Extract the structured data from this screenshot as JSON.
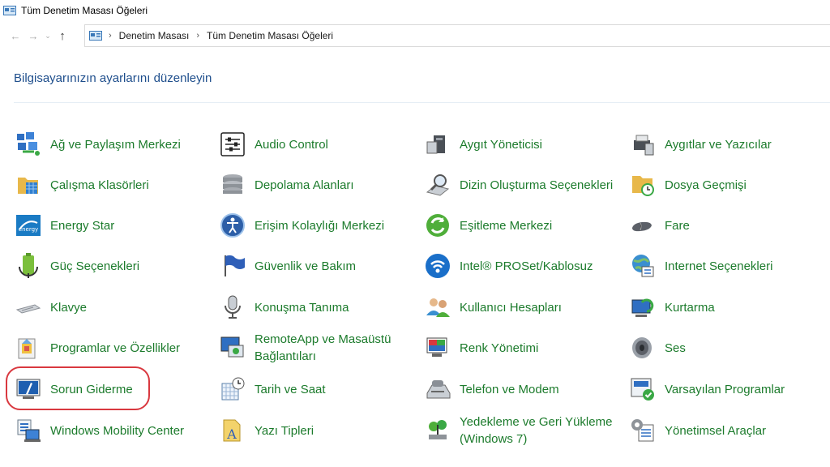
{
  "window": {
    "title": "Tüm Denetim Masası Öğeleri"
  },
  "address": {
    "crumbs": [
      "Denetim Masası",
      "Tüm Denetim Masası Öğeleri"
    ],
    "back_icon": "back-arrow-icon",
    "forward_icon": "forward-arrow-icon",
    "up_icon": "up-arrow-icon"
  },
  "heading": "Bilgisayarınızın ayarlarını düzenleyin",
  "colors": {
    "link": "#1c7b2c",
    "heading": "#1e4e8c",
    "highlight": "#d9383f"
  },
  "columns": [
    {
      "items": [
        {
          "label": "Ağ ve Paylaşım Merkezi",
          "icon": "network-icon"
        },
        {
          "label": "Çalışma Klasörleri",
          "icon": "work-folders-icon"
        },
        {
          "label": "Energy Star",
          "icon": "energy-star-icon"
        },
        {
          "label": "Güç Seçenekleri",
          "icon": "power-options-icon"
        },
        {
          "label": "Klavye",
          "icon": "keyboard-icon"
        },
        {
          "label": "Programlar ve Özellikler",
          "icon": "programs-icon"
        },
        {
          "label": "Sorun Giderme",
          "icon": "troubleshooting-icon",
          "highlighted": true
        },
        {
          "label": "Windows Mobility Center",
          "icon": "mobility-center-icon"
        }
      ]
    },
    {
      "items": [
        {
          "label": "Audio Control",
          "icon": "audio-control-icon"
        },
        {
          "label": "Depolama Alanları",
          "icon": "storage-spaces-icon"
        },
        {
          "label": "Erişim Kolaylığı Merkezi",
          "icon": "ease-of-access-icon"
        },
        {
          "label": "Güvenlik ve Bakım",
          "icon": "security-maintenance-icon"
        },
        {
          "label": "Konuşma Tanıma",
          "icon": "speech-recognition-icon"
        },
        {
          "label": "RemoteApp ve Masaüstü Bağlantıları",
          "icon": "remoteapp-icon"
        },
        {
          "label": "Tarih ve Saat",
          "icon": "date-time-icon"
        },
        {
          "label": "Yazı Tipleri",
          "icon": "fonts-icon"
        }
      ]
    },
    {
      "items": [
        {
          "label": "Aygıt Yöneticisi",
          "icon": "device-manager-icon"
        },
        {
          "label": "Dizin Oluşturma Seçenekleri",
          "icon": "indexing-options-icon"
        },
        {
          "label": "Eşitleme Merkezi",
          "icon": "sync-center-icon"
        },
        {
          "label": "Intel® PROSet/Kablosuz",
          "icon": "wireless-icon"
        },
        {
          "label": "Kullanıcı Hesapları",
          "icon": "user-accounts-icon"
        },
        {
          "label": "Renk Yönetimi",
          "icon": "color-management-icon"
        },
        {
          "label": "Telefon ve Modem",
          "icon": "phone-modem-icon"
        },
        {
          "label": "Yedekleme ve Geri Yükleme (Windows 7)",
          "icon": "backup-restore-icon"
        }
      ]
    },
    {
      "items": [
        {
          "label": "Aygıtlar ve Yazıcılar",
          "icon": "devices-printers-icon"
        },
        {
          "label": "Dosya Geçmişi",
          "icon": "file-history-icon"
        },
        {
          "label": "Fare",
          "icon": "mouse-icon"
        },
        {
          "label": "Internet Seçenekleri",
          "icon": "internet-options-icon"
        },
        {
          "label": "Kurtarma",
          "icon": "recovery-icon"
        },
        {
          "label": "Ses",
          "icon": "sound-icon"
        },
        {
          "label": "Varsayılan Programlar",
          "icon": "default-programs-icon"
        },
        {
          "label": "Yönetimsel Araçlar",
          "icon": "admin-tools-icon"
        }
      ]
    }
  ]
}
